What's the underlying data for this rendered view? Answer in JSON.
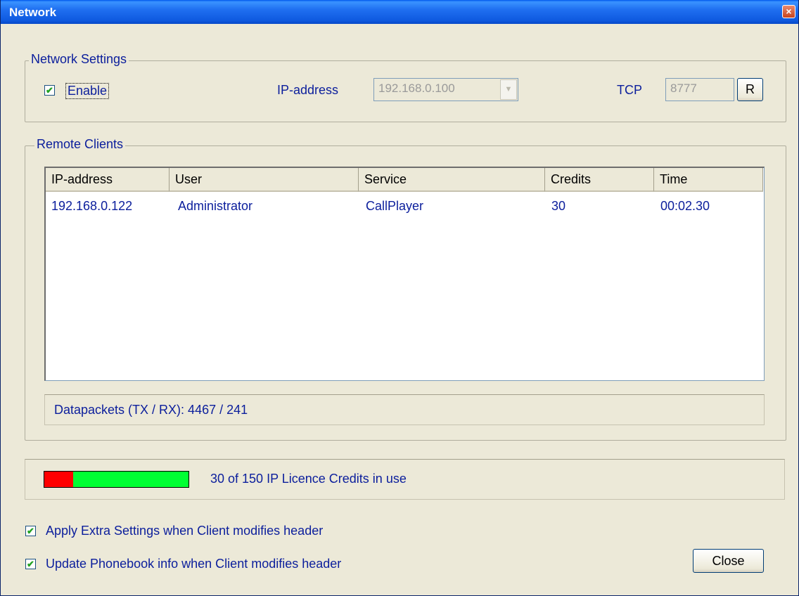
{
  "window": {
    "title": "Network",
    "close_glyph": "×"
  },
  "network_settings": {
    "legend": "Network Settings",
    "enable_label": "Enable",
    "enable_checked": true,
    "ip_label": "IP-address",
    "ip_value": "192.168.0.100",
    "tcp_label": "TCP",
    "tcp_value": "8777",
    "reset_label": "R"
  },
  "remote_clients": {
    "legend": "Remote Clients",
    "columns": [
      "IP-address",
      "User",
      "Service",
      "Credits",
      "Time"
    ],
    "rows": [
      [
        "192.168.0.122",
        "Administrator",
        "CallPlayer",
        "30",
        "00:02.30"
      ]
    ],
    "datapackets": "Datapackets (TX / RX): 4467 / 241"
  },
  "credits": {
    "text": "30 of 150 IP Licence Credits in use",
    "used": 30,
    "total": 150,
    "used_color": "#ff0000",
    "free_color": "#00ff33"
  },
  "options": [
    {
      "label": "Apply Extra Settings when Client modifies header",
      "checked": true
    },
    {
      "label": "Update Phonebook info when Client modifies header",
      "checked": true
    }
  ],
  "close_button": "Close",
  "icons": {
    "checkmark": "✔",
    "dropdown": "▼"
  }
}
